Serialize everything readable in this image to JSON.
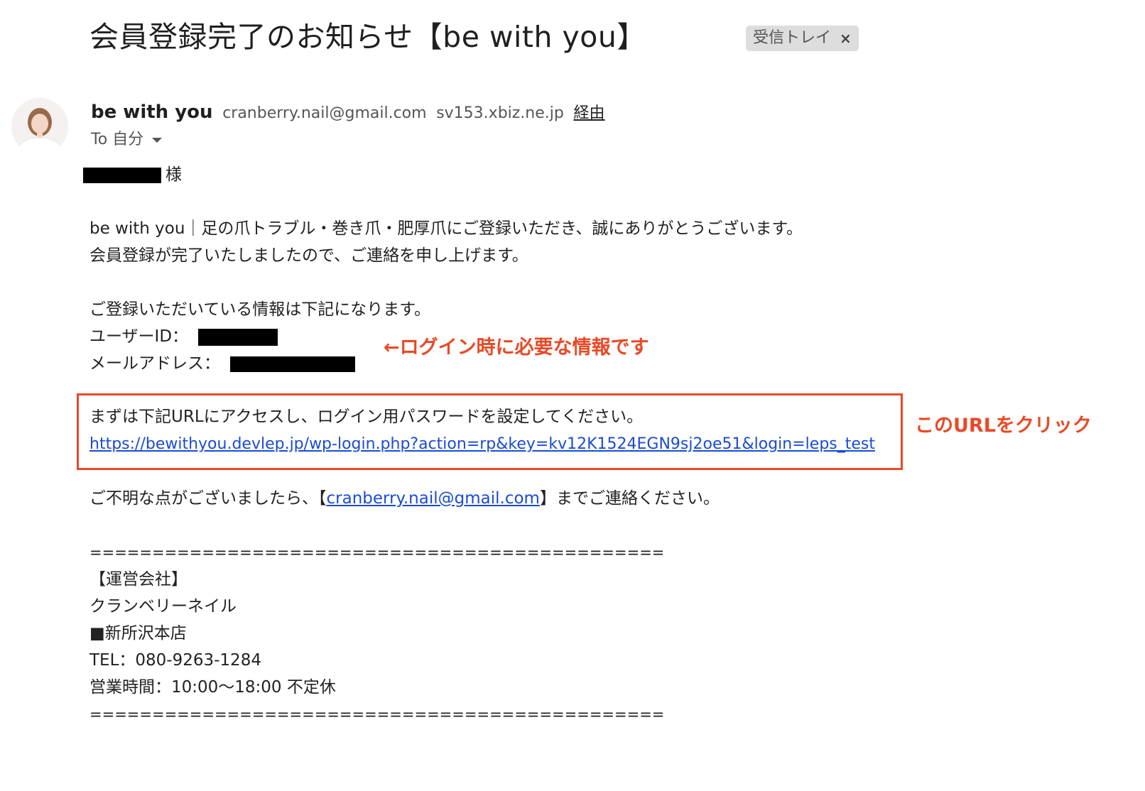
{
  "email": {
    "subject": "会員登録完了のお知らせ【be with you】",
    "label": {
      "text": "受信トレイ",
      "remove_symbol": "×"
    },
    "sender": {
      "name": "be with you",
      "email": "cranberry.nail@gmail.com",
      "server": "sv153.xbiz.ne.jp",
      "via_label": "経由"
    },
    "recipient": {
      "to_label": "To 自分"
    },
    "body": {
      "greeting_suffix": "様",
      "intro_line1": "be with you｜足の爪トラブル・巻き爪・肥厚爪にご登録いただき、誠にありがとうございます。",
      "intro_line2": "会員登録が完了いたしましたので、ご連絡を申し上げます。",
      "info_heading": "ご登録いただいている情報は下記になります。",
      "user_id_label": "ユーザーID：",
      "email_label": "メールアドレス：",
      "url_instruction": "まずは下記URLにアクセスし、ログイン用パスワードを設定してください。",
      "reset_url": "https://bewithyou.devlep.jp/wp-login.php?action=rp&key=kv12K1524EGN9sj2oe51&login=leps_test",
      "contact_prefix": "ご不明な点がございましたら、【",
      "contact_email": "cranberry.nail@gmail.com",
      "contact_suffix": "】までご連絡ください。",
      "divider": "==============================================",
      "company_heading": "【運営会社】",
      "company_name": "クランベリーネイル",
      "store_name": "■新所沢本店",
      "tel": "TEL：080-9263-1284",
      "hours": "営業時間：10:00〜18:00 不定休"
    }
  },
  "annotations": {
    "login_info_note": "←ログイン時に必要な情報です",
    "click_url_note": "このURLをクリック",
    "color": "#e84a27"
  },
  "icons": {
    "avatar": "sender-avatar",
    "dropdown": "chevron-down-icon",
    "close": "close-icon"
  }
}
